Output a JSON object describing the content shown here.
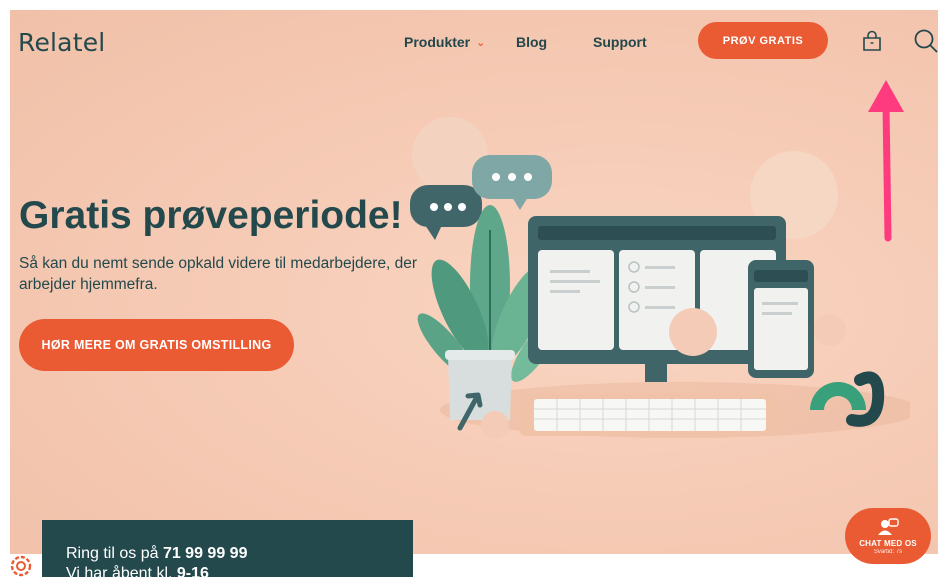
{
  "header": {
    "logo": "Relatel",
    "nav": {
      "products": "Produkter",
      "blog": "Blog",
      "support": "Support"
    },
    "try_button": "PRØV GRATIS",
    "icons": [
      "bag-icon",
      "search-icon",
      "chevron-down-icon"
    ]
  },
  "hero": {
    "title": "Gratis prøveperiode!",
    "subtitle": "Så kan du nemt sende opkald videre til medarbejdere, der arbejder hjemmefra.",
    "cta": "HØR MERE OM GRATIS OMSTILLING"
  },
  "call_box": {
    "line1_prefix": "Ring til os på ",
    "phone": "71 99 99 99",
    "line2_prefix": "Vi har åbent kl. ",
    "hours": "9-16"
  },
  "chat": {
    "label": "CHAT MED OS",
    "sub": "Svartid: 7s"
  },
  "colors": {
    "brand_dark": "#24494d",
    "accent": "#ea5b34",
    "hero_bg": "#f5c9b3",
    "annotation_arrow": "#ff3b7f"
  }
}
